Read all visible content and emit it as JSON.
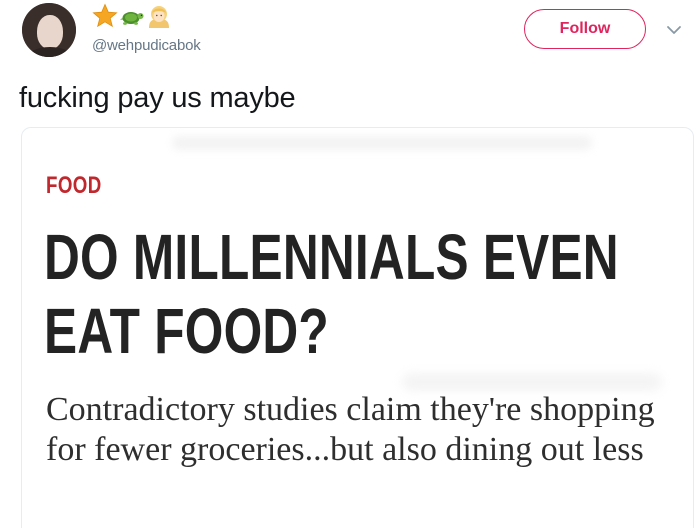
{
  "user": {
    "handle": "@wehpudicabok",
    "name_emojis": [
      "star-emoji",
      "turtle-emoji",
      "person-blond-hair-emoji"
    ],
    "follow_label": "Follow"
  },
  "tweet": {
    "text": "fucking pay us maybe"
  },
  "article": {
    "kicker": "FOOD",
    "headline": "DO MILLENNIALS EVEN EAT FOOD?",
    "dek": "Contradictory studies claim they're shopping for fewer groceries...but also dining out less"
  },
  "colors": {
    "follow_accent": "#e0245e",
    "kicker_red": "#c0282d",
    "handle_gray": "#657786"
  }
}
